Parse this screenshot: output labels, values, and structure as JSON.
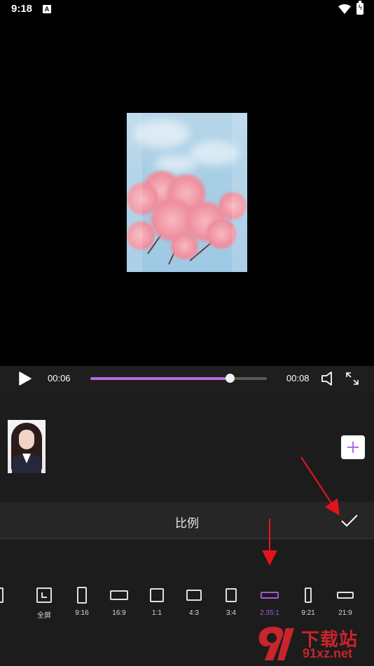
{
  "status_bar": {
    "time": "9:18",
    "app_icon_letter": "A",
    "battery_glyph": "ϟ"
  },
  "player": {
    "current_time": "00:06",
    "total_time": "00:08",
    "progress_fraction": 0.79,
    "accent_color": "#b66bdc"
  },
  "panel": {
    "title": "比例"
  },
  "ratios": {
    "items": [
      {
        "label": "",
        "icon": "partial-ratio-icon"
      },
      {
        "label": "全屏",
        "icon": "fullscreen-ratio-icon"
      },
      {
        "label": "9:16",
        "icon": "portrait-9-16-icon"
      },
      {
        "label": "16:9",
        "icon": "landscape-16-9-icon"
      },
      {
        "label": "1:1",
        "icon": "square-1-1-icon"
      },
      {
        "label": "4:3",
        "icon": "landscape-4-3-icon"
      },
      {
        "label": "3:4",
        "icon": "portrait-3-4-icon"
      },
      {
        "label": "2.35:1",
        "icon": "widescreen-2-35-1-icon",
        "selected": true
      },
      {
        "label": "9:21",
        "icon": "portrait-9-21-icon"
      },
      {
        "label": "21:9",
        "icon": "landscape-21-9-icon"
      }
    ],
    "selected_color": "#a25ad4"
  },
  "watermark": {
    "cn_text": "下载站",
    "url_text": "91xz.net",
    "color": "#c8252c"
  }
}
